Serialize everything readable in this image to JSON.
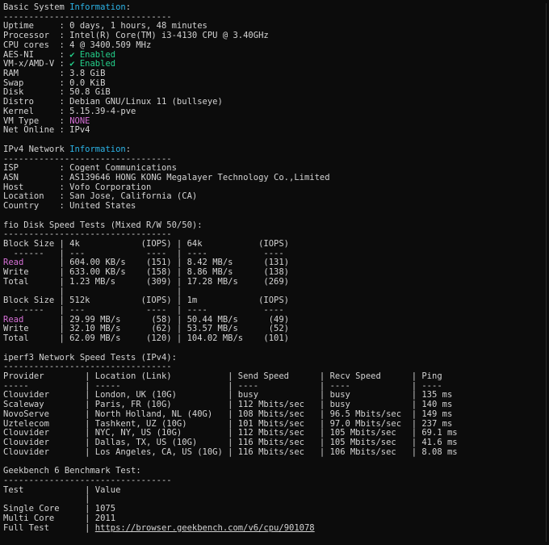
{
  "terminal": {
    "lines": [
      [
        {
          "t": "Basic System "
        },
        {
          "t": "Information",
          "c": "c-cyan"
        },
        {
          "t": ":"
        }
      ],
      [
        {
          "t": "---------------------------------"
        }
      ],
      [
        {
          "t": "Uptime     : 0 days, 1 hours, 48 minutes"
        }
      ],
      [
        {
          "t": "Processor  : Intel(R) Core(TM) i3-4130 CPU @ 3.40GHz"
        }
      ],
      [
        {
          "t": "CPU cores  : 4 @ 3400.509 MHz"
        }
      ],
      [
        {
          "t": "AES-NI     : "
        },
        {
          "t": "✔ Enabled",
          "c": "c-green"
        }
      ],
      [
        {
          "t": "VM-x/AMD-V : "
        },
        {
          "t": "✔ Enabled",
          "c": "c-green"
        }
      ],
      [
        {
          "t": "RAM        : 3.8 GiB"
        }
      ],
      [
        {
          "t": "Swap       : 0.0 KiB"
        }
      ],
      [
        {
          "t": "Disk       : 50.8 GiB"
        }
      ],
      [
        {
          "t": "Distro     : Debian GNU/Linux 11 (bullseye)"
        }
      ],
      [
        {
          "t": "Kernel     : 5.15.39-4-pve"
        }
      ],
      [
        {
          "t": "VM Type    : "
        },
        {
          "t": "NONE",
          "c": "c-magenta"
        }
      ],
      [
        {
          "t": "Net Online : IPv4"
        }
      ],
      [
        {
          "t": ""
        }
      ],
      [
        {
          "t": "IPv4 Network "
        },
        {
          "t": "Information",
          "c": "c-cyan"
        },
        {
          "t": ":"
        }
      ],
      [
        {
          "t": "---------------------------------"
        }
      ],
      [
        {
          "t": "ISP        : Cogent Communications"
        }
      ],
      [
        {
          "t": "ASN        : AS139646 HONG KONG Megalayer Technology Co.,Limited"
        }
      ],
      [
        {
          "t": "Host       : Vofo Corporation"
        }
      ],
      [
        {
          "t": "Location   : San Jose, California (CA)"
        }
      ],
      [
        {
          "t": "Country    : United States"
        }
      ],
      [
        {
          "t": ""
        }
      ],
      [
        {
          "t": "fio Disk Speed Tests (Mixed R/W 50/50):"
        }
      ],
      [
        {
          "t": "---------------------------------"
        }
      ],
      [
        {
          "t": "Block Size | 4k            (IOPS) | 64k           (IOPS)"
        }
      ],
      [
        {
          "t": "  ------   | ---            ----  | ----           ---- "
        }
      ],
      [
        {
          "t": "Read",
          "c": "c-magenta"
        },
        {
          "t": "       | 604.00 KB/s    (151) | 8.42 MB/s      (131)"
        }
      ],
      [
        {
          "t": "Write      | 633.00 KB/s    (158) | 8.86 MB/s      (138)"
        }
      ],
      [
        {
          "t": "Total      | 1.23 MB/s      (309) | 17.28 MB/s     (269)"
        }
      ],
      [
        {
          "t": "           |                      |                     "
        }
      ],
      [
        {
          "t": "Block Size | 512k          (IOPS) | 1m            (IOPS)"
        }
      ],
      [
        {
          "t": "  ------   | ---            ----  | ----           ---- "
        }
      ],
      [
        {
          "t": "Read",
          "c": "c-magenta"
        },
        {
          "t": "       | 29.99 MB/s      (58) | 50.44 MB/s      (49)"
        }
      ],
      [
        {
          "t": "Write      | 32.10 MB/s      (62) | 53.57 MB/s      (52)"
        }
      ],
      [
        {
          "t": "Total      | 62.09 MB/s     (120) | 104.02 MB/s    (101)"
        }
      ],
      [
        {
          "t": ""
        }
      ],
      [
        {
          "t": "iperf3 Network Speed Tests (IPv4):"
        }
      ],
      [
        {
          "t": "---------------------------------"
        }
      ],
      [
        {
          "t": "Provider        | Location (Link)           | Send Speed      | Recv Speed      | Ping"
        }
      ],
      [
        {
          "t": "-----           | -----                     | ----            | ----            | ----"
        }
      ],
      [
        {
          "t": "Clouvider       | London, UK (10G)          | busy            | busy            | 135 ms"
        }
      ],
      [
        {
          "t": "Scaleway        | Paris, FR (10G)           | 112 Mbits/sec   | busy            | 140 ms"
        }
      ],
      [
        {
          "t": "NovoServe       | North Holland, NL (40G)   | 108 Mbits/sec   | 96.5 Mbits/sec  | 149 ms"
        }
      ],
      [
        {
          "t": "Uztelecom       | Tashkent, UZ (10G)        | 101 Mbits/sec   | 97.0 Mbits/sec  | 237 ms"
        }
      ],
      [
        {
          "t": "Clouvider       | NYC, NY, US (10G)         | 112 Mbits/sec   | 105 Mbits/sec   | 69.1 ms"
        }
      ],
      [
        {
          "t": "Clouvider       | Dallas, TX, US (10G)      | 116 Mbits/sec   | 105 Mbits/sec   | 41.6 ms"
        }
      ],
      [
        {
          "t": "Clouvider       | Los Angeles, CA, US (10G) | 116 Mbits/sec   | 106 Mbits/sec   | 8.08 ms"
        }
      ],
      [
        {
          "t": ""
        }
      ],
      [
        {
          "t": "Geekbench 6 Benchmark Test:"
        }
      ],
      [
        {
          "t": "---------------------------------"
        }
      ],
      [
        {
          "t": "Test            | Value"
        }
      ],
      [
        {
          "t": "                |"
        }
      ],
      [
        {
          "t": "Single Core     | 1075"
        }
      ],
      [
        {
          "t": "Multi Core      | 2011"
        }
      ],
      [
        {
          "t": "Full Test       | "
        },
        {
          "t": "https://browser.geekbench.com/v6/cpu/901078",
          "c": "c-link"
        }
      ]
    ]
  }
}
